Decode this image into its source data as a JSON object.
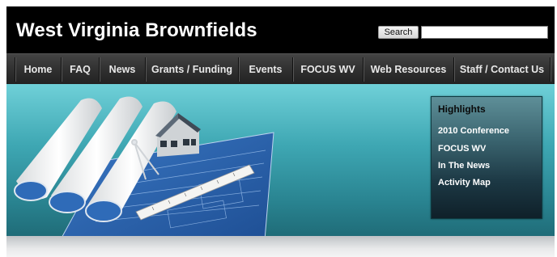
{
  "header": {
    "site_title": "West Virginia Brownfields",
    "search_button": "Search",
    "search_value": ""
  },
  "nav": [
    {
      "label": "Home"
    },
    {
      "label": "FAQ"
    },
    {
      "label": "News"
    },
    {
      "label": "Grants / Funding"
    },
    {
      "label": "Events"
    },
    {
      "label": "FOCUS WV"
    },
    {
      "label": "Web Resources"
    },
    {
      "label": "Staff / Contact Us"
    }
  ],
  "highlights": {
    "title": "Highlights",
    "links": [
      {
        "label": "2010 Conference"
      },
      {
        "label": "FOCUS WV"
      },
      {
        "label": "In The News"
      },
      {
        "label": "Activity Map"
      }
    ]
  },
  "colors": {
    "header_bg": "#000000",
    "nav_bg": "#333333",
    "hero_teal": "#3ea7b3",
    "blueprint_blue": "#2e63b0"
  }
}
